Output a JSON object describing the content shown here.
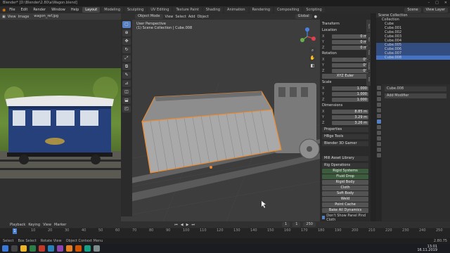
{
  "window": {
    "title": "Blender* [D:\\Blender\\2.80\\a\\Wagon.blend]"
  },
  "menu": {
    "items": [
      "File",
      "Edit",
      "Render",
      "Window",
      "Help"
    ],
    "workspaces": [
      "Layout",
      "Modeling",
      "Sculpting",
      "UV Editing",
      "Texture Paint",
      "Shading",
      "Animation",
      "Rendering",
      "Compositing",
      "Scripting"
    ],
    "active_workspace": "Layout",
    "scene": "Scene",
    "view_layer": "View Layer"
  },
  "image_editor": {
    "view": "View",
    "image": "Image",
    "image_name": "wagon_ref.jpg"
  },
  "viewport": {
    "mode": "Object Mode",
    "menus": [
      "View",
      "Select",
      "Add",
      "Object"
    ],
    "global": "Global",
    "view_name": "User Perspective",
    "collection_info": "(1) Scene Collection | Cube.008"
  },
  "npanel": {
    "transform": "Transform",
    "location": "Location",
    "rotation": "Rotation",
    "scale": "Scale",
    "dimensions": "Dimensions",
    "axes": [
      "X",
      "Y",
      "Z"
    ],
    "location_vals": [
      "0 m",
      "0 m",
      "0 m"
    ],
    "rotation_vals": [
      "0°",
      "0°",
      "0°"
    ],
    "scale_vals": [
      "1.000",
      "1.000",
      "1.000"
    ],
    "dimensions_vals": [
      "8.85 m",
      "3.29 m",
      "3.26 m"
    ],
    "mode": "XYZ Euler",
    "sections": [
      "Properties",
      "HBge Tools",
      "Blender 3D Gamer"
    ],
    "library": "Mill Asset Library",
    "rig": "Rig Operations",
    "buttons": [
      "Rigid Systems",
      "Fluid Drop",
      "Rigid Body",
      "Cloth",
      "Soft Body",
      "Weld",
      "Point Cache",
      "Bake All Dynamics"
    ],
    "bake_toggle": "Don't Show Panel Pind Cloth",
    "tabs": [
      "Item",
      "Tool",
      "View",
      "Create",
      "Edit"
    ]
  },
  "outliner": {
    "header": "Scene Collection",
    "rows": [
      "Collection",
      "Cube",
      "Cube.001",
      "Cube.002",
      "Cube.003",
      "Cube.004",
      "Cube.005",
      "Cube.006",
      "Cube.007",
      "Cube.008"
    ],
    "selected_index": 9
  },
  "properties": {
    "object_name": "Cube.008",
    "section": "Add Modifier"
  },
  "timeline": {
    "menus": [
      "Playback",
      "Keying",
      "View",
      "Marker"
    ],
    "frame": "1",
    "ticks": [
      "1",
      "10",
      "20",
      "30",
      "40",
      "50",
      "60",
      "70",
      "80",
      "90",
      "100",
      "110",
      "120",
      "130",
      "140",
      "150",
      "160",
      "170",
      "180",
      "190",
      "200",
      "210",
      "220",
      "230",
      "240",
      "250"
    ],
    "start": "1",
    "end": "250",
    "version": "2.80.75"
  },
  "statusbar": {
    "items": [
      "Select",
      "Box Select",
      "Rotate View",
      "Object Context Menu"
    ]
  },
  "taskbar": {
    "time": "13:01",
    "date": "16.11.2019"
  }
}
